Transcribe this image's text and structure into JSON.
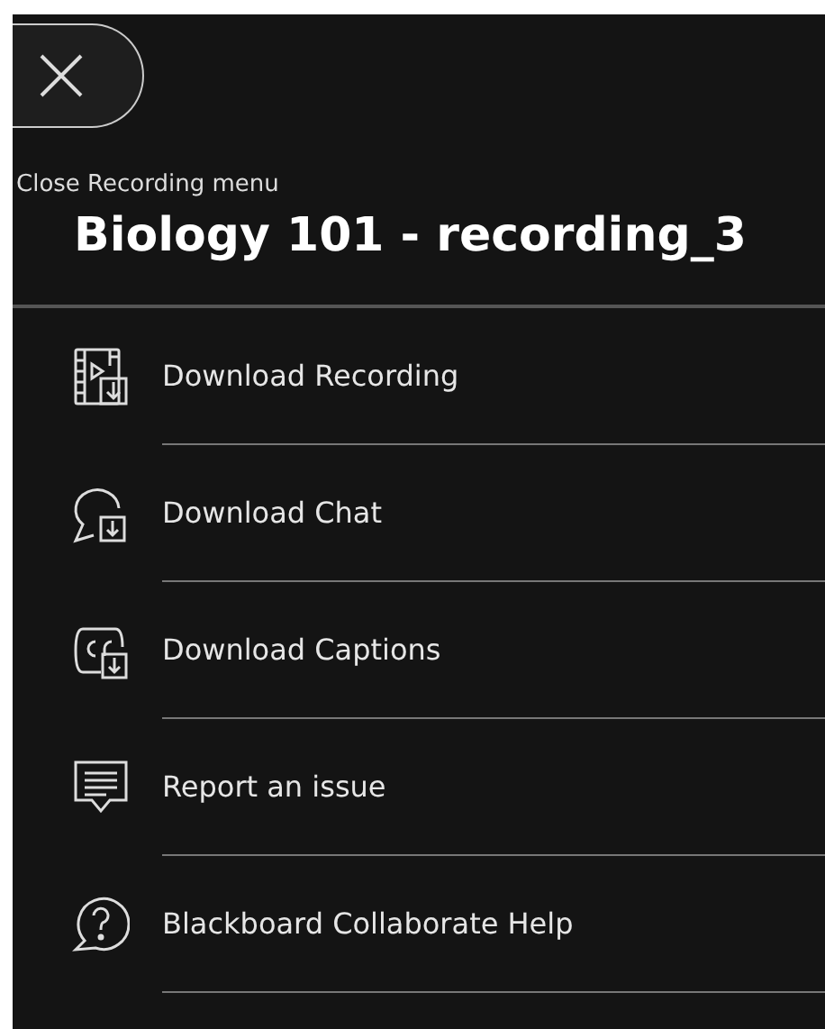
{
  "close_button": {
    "tooltip": "Close Recording menu"
  },
  "title": "Biology 101 - recording_3",
  "menu_items": [
    {
      "kind": "recording",
      "label": "Download Recording"
    },
    {
      "kind": "chat",
      "label": "Download Chat"
    },
    {
      "kind": "captions",
      "label": "Download Captions"
    },
    {
      "kind": "report",
      "label": "Report an issue"
    },
    {
      "kind": "help",
      "label": "Blackboard Collaborate Help"
    }
  ]
}
